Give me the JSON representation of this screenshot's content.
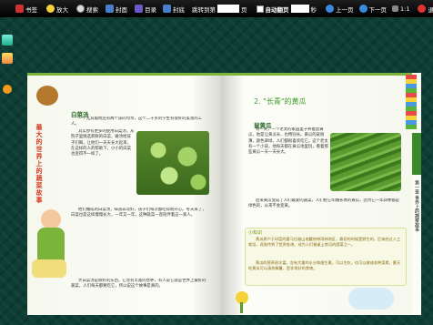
{
  "toolbar": {
    "bookmark": "书签",
    "zoom_in": "放大",
    "search": "搜索",
    "cover": "封面",
    "toc": "目录",
    "back_cover": "封底",
    "jump_to": "跳转到第",
    "page_value": "",
    "page_unit": "页",
    "auto_flip": "自动翻页",
    "seconds_value": "",
    "seconds_unit": "秒",
    "prev": "上一页",
    "next": "下一页",
    "ratio": "1:1",
    "exit": "退出"
  },
  "left_page": {
    "side_title": "最大的世界上的蔬菜故事",
    "section": "白菜汤",
    "para1": "一个尤其聪明还有两个孩的母亲，这个二十岁的学生有很好的美景的工人。",
    "para2": "其实你有更多的使用白菜汤，从院子里挑选新鲜的白菜，做汤给孩子们喝，让他们一天天长大起来，在这样的人的帮助下，小小的白菜也变得不一样了。",
    "para3": "他们做成的白菜汤，味道非常好，孩子们每次都吃得很开心。冬天来了，白菜也是这样慢慢长大，一年又一年，这种蔬菜一直陪伴着这一家人。",
    "para4": "大白菜汤是很好的东西，它含有丰富的营养，有人说它就是世界上最好的蔬菜，人们每天都要吃它，所以说这个故事是真的。"
  },
  "right_page": {
    "section_title": "2. \"长青\"的黄瓜",
    "subsection": "鼠黄瓜",
    "para1": "有一天，一个老太的家园里子养着鼠黄瓜，他是让黄瓜长、也特别长。黄瓜的皮很薄，颜色翠绿，人们都很喜欢吃它。这个老太有一个小孩，他每天都在黄瓜地里玩，看着那些黄瓜一天一天长大。",
    "para2": "后来黄瓜变成了人们最爱的蔬菜，人们把它叫做长青的黄瓜，因为它一年四季都是绿色的，从来不会变黄。",
    "box_title": "小知识",
    "box_para1": "黄瓜原产于印度的喜马拉雅山南麓热带雨林地区，最初的时候是野生的，后来经过人工栽培，逐渐传到了世界各地，成为人们餐桌上常见的蔬菜之一。",
    "box_para2": "黄瓜的营养很丰富，含有大量的水分和维生素，可以生吃，也可以做成各种菜肴，夏天吃黄瓜可以清热解暑，是非常好的食物。",
    "side_tab": "第一章 世界上的蔬菜故事"
  },
  "colors": {
    "toolbar_bg": "#000000",
    "accent_green": "#3a9a2a",
    "accent_red": "#d23a20"
  }
}
